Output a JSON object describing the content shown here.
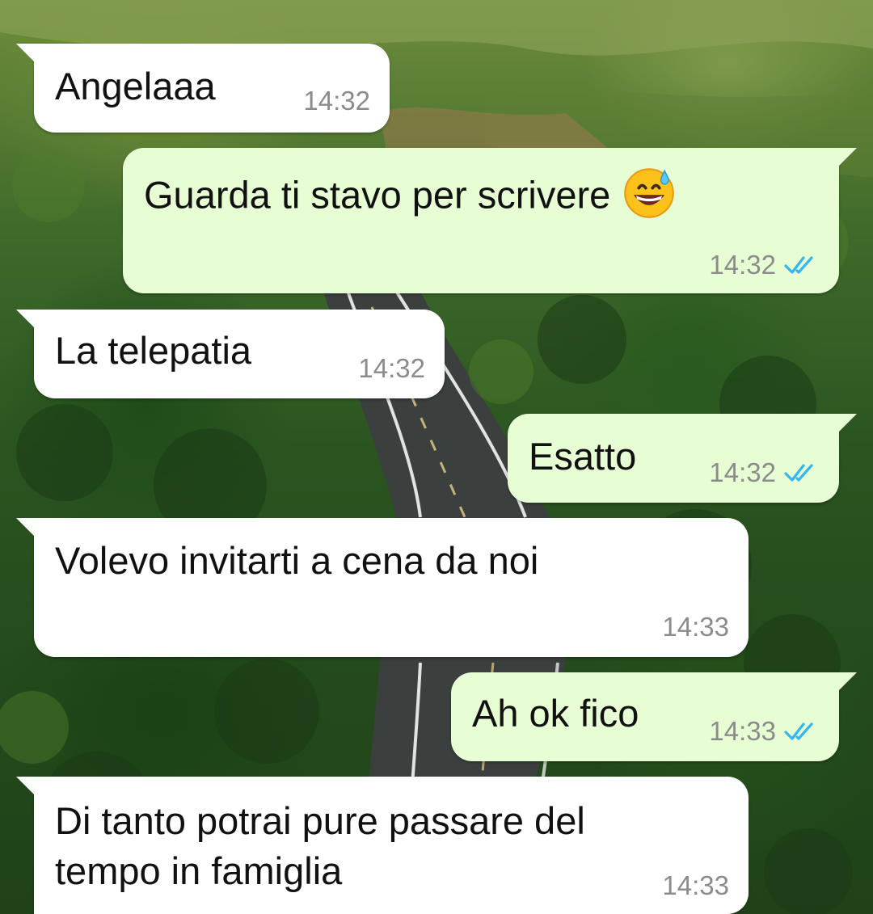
{
  "theme": {
    "incoming_bubble": "#ffffff",
    "outgoing_bubble": "#e7fed5",
    "read_tick_color": "#34b7f1",
    "timestamp_color": "#8b8b8b"
  },
  "messages": [
    {
      "id": "m1",
      "direction": "incoming",
      "text": "Angelaaa",
      "time": "14:32"
    },
    {
      "id": "m2",
      "direction": "outgoing",
      "text": "Guarda ti stavo per scrivere",
      "emoji": "grinning-face-with-sweat",
      "time": "14:32",
      "status": "read"
    },
    {
      "id": "m3",
      "direction": "incoming",
      "text": "La telepatia",
      "time": "14:32"
    },
    {
      "id": "m4",
      "direction": "outgoing",
      "text": "Esatto",
      "time": "14:32",
      "status": "read"
    },
    {
      "id": "m5",
      "direction": "incoming",
      "text": "Volevo invitarti a cena da noi",
      "time": "14:33"
    },
    {
      "id": "m6",
      "direction": "outgoing",
      "text": "Ah ok fico",
      "time": "14:33",
      "status": "read"
    },
    {
      "id": "m7",
      "direction": "incoming",
      "text": "Di tanto potrai pure passare del\ntempo in famiglia",
      "time": "14:33"
    }
  ]
}
